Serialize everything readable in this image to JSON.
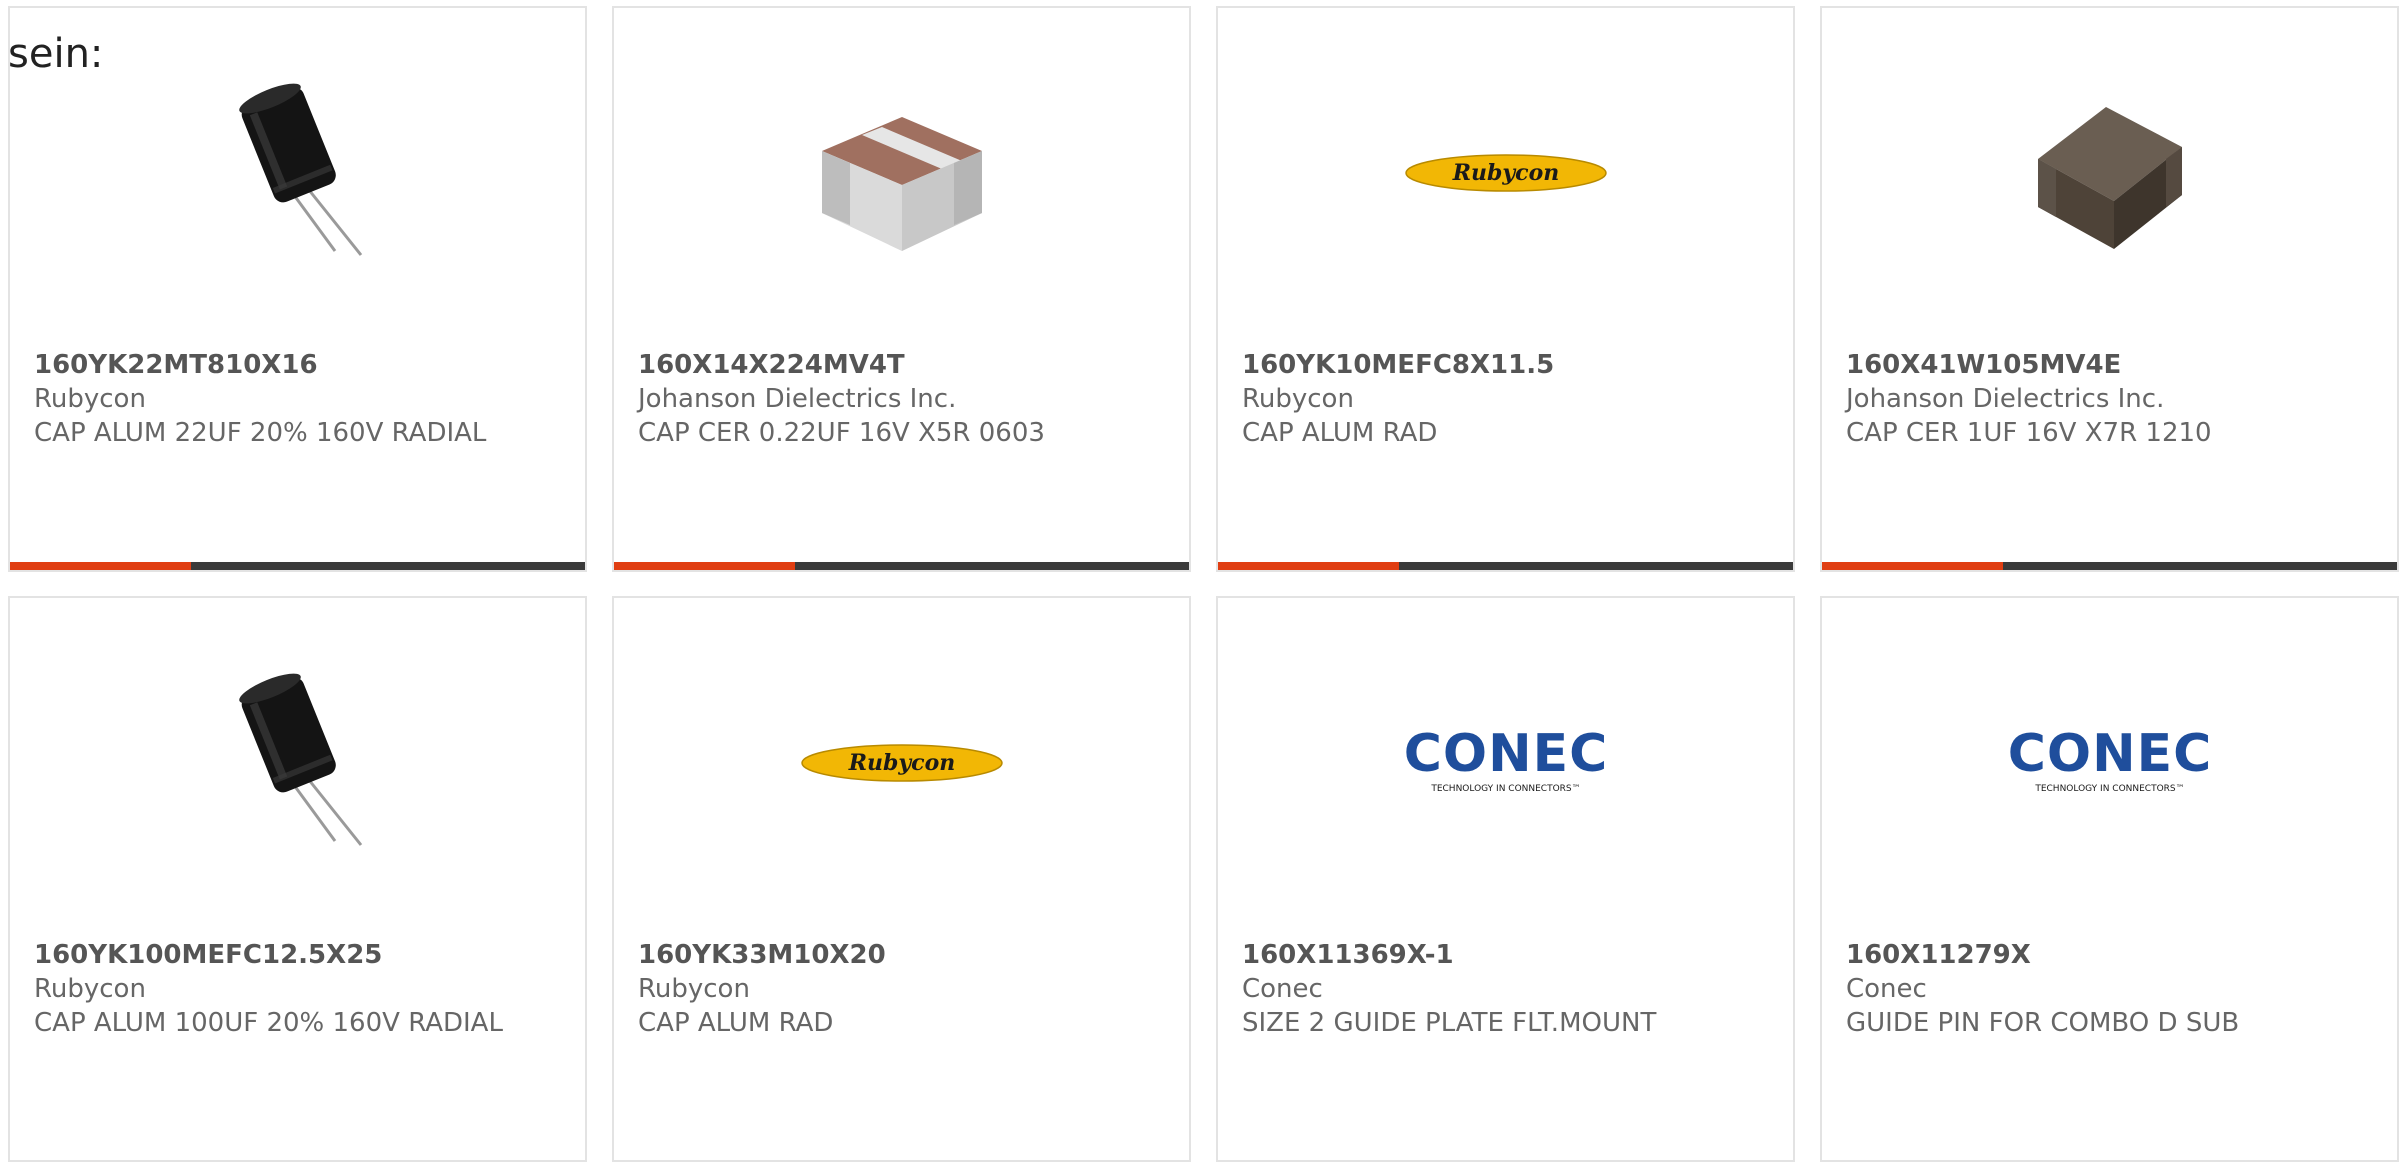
{
  "intro_text": "sein:",
  "colors": {
    "accent_bar": "#e03e12",
    "bar_base": "#3a3a3a",
    "card_border": "#e3e3e3",
    "text": "#666666"
  },
  "products": [
    {
      "part_number": "160YK22MT810X16",
      "manufacturer": "Rubycon",
      "description": "CAP ALUM 22UF 20% 160V RADIAL",
      "image": "radial-electrolytic-capacitor-image"
    },
    {
      "part_number": "160X14X224MV4T",
      "manufacturer": "Johanson Dielectrics Inc.",
      "description": "CAP CER 0.22UF 16V X5R 0603",
      "image": "smd-ceramic-chip-capacitor-image"
    },
    {
      "part_number": "160YK10MEFC8X11.5",
      "manufacturer": "Rubycon",
      "description": "CAP ALUM RAD",
      "image": "rubycon-logo",
      "logo_text": "Rubycon"
    },
    {
      "part_number": "160X41W105MV4E",
      "manufacturer": "Johanson Dielectrics Inc.",
      "description": "CAP CER 1UF 16V X7R 1210",
      "image": "smd-ceramic-capacitor-dark-image"
    },
    {
      "part_number": "160YK100MEFC12.5X25",
      "manufacturer": "Rubycon",
      "description": "CAP ALUM 100UF 20% 160V RADIAL",
      "image": "radial-electrolytic-capacitor-image"
    },
    {
      "part_number": "160YK33M10X20",
      "manufacturer": "Rubycon",
      "description": "CAP ALUM RAD",
      "image": "rubycon-logo",
      "logo_text": "Rubycon"
    },
    {
      "part_number": "160X11369X-1",
      "manufacturer": "Conec",
      "description": "SIZE 2 GUIDE PLATE FLT.MOUNT",
      "image": "conec-logo",
      "logo_text": "CONEC",
      "logo_tagline": "TECHNOLOGY IN CONNECTORS™"
    },
    {
      "part_number": "160X11279X",
      "manufacturer": "Conec",
      "description": "GUIDE PIN FOR COMBO D SUB",
      "image": "conec-logo",
      "logo_text": "CONEC",
      "logo_tagline": "TECHNOLOGY IN CONNECTORS™"
    }
  ]
}
